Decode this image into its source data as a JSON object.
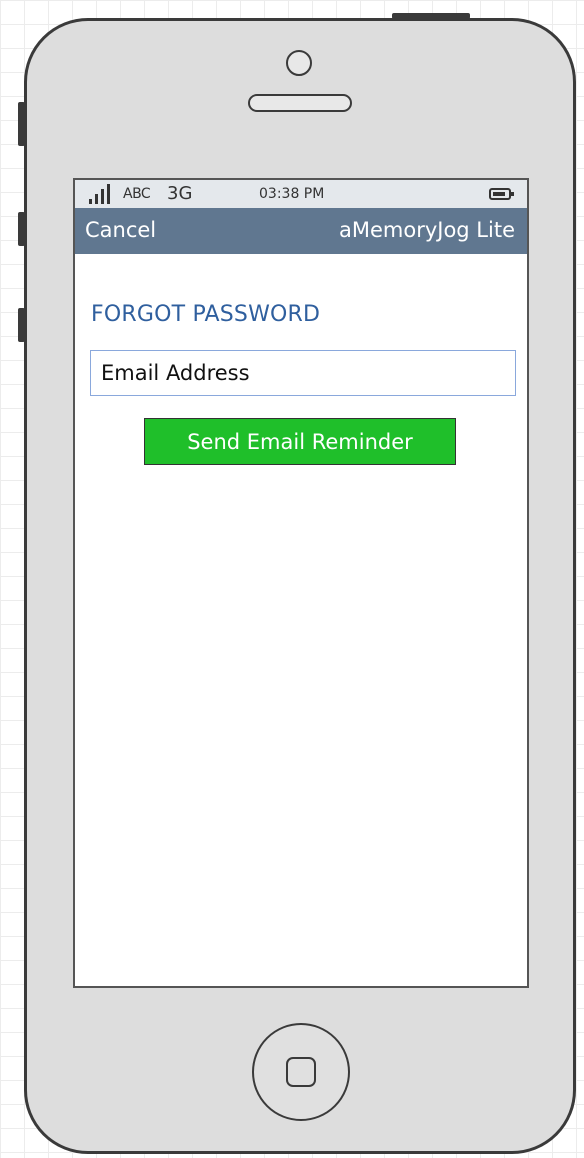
{
  "status_bar": {
    "carrier": "ABC",
    "network": "3G",
    "time": "03:38 PM",
    "signal_icon": "signal-bars-icon",
    "battery_icon": "battery-icon"
  },
  "nav": {
    "cancel_label": "Cancel",
    "title": "aMemoryJog Lite",
    "background_color": "#607790"
  },
  "form": {
    "heading": "FORGOT PASSWORD",
    "email_placeholder": "Email Address",
    "email_value": "",
    "submit_label": "Send Email Reminder",
    "submit_color": "#1fbf2a",
    "heading_color": "#2f5f9e"
  }
}
